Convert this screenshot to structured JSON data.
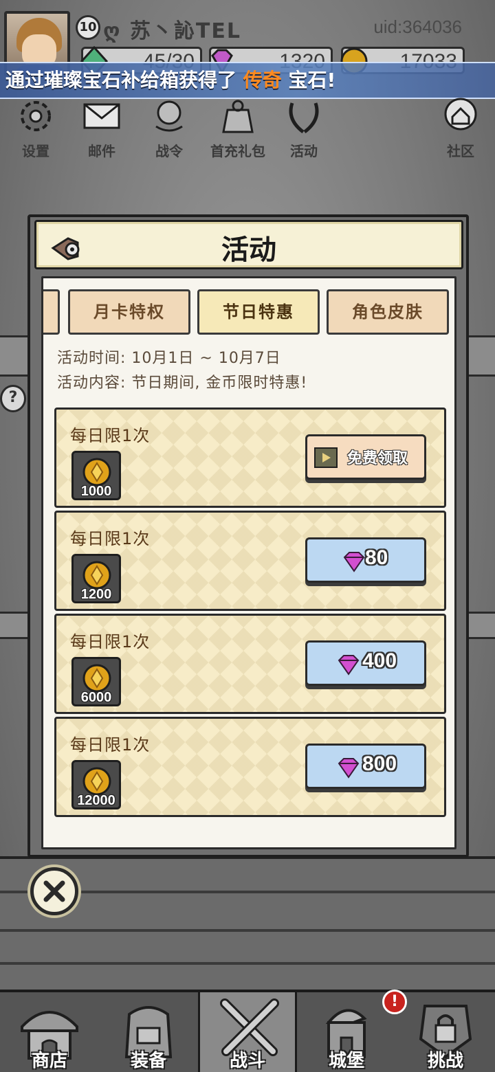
{
  "player": {
    "level": "10",
    "name": "ღ 苏丶訫TEL",
    "uid": "uid:364036"
  },
  "resources": {
    "energy": "45/30",
    "gems": "1320",
    "gold": "17033"
  },
  "banner": {
    "prefix": "通过璀璨宝石补给箱获得了",
    "highlight": "传奇",
    "suffix": "宝石!"
  },
  "top_menu": [
    {
      "label": "设置",
      "icon": "gear-icon"
    },
    {
      "label": "邮件",
      "icon": "mail-icon"
    },
    {
      "label": "战令",
      "icon": "battle-pass-icon"
    },
    {
      "label": "首充礼包",
      "icon": "gift-bag-icon"
    },
    {
      "label": "活动",
      "icon": "laurel-icon"
    },
    {
      "label": "社区",
      "icon": "home-icon"
    }
  ],
  "dialog": {
    "title": "活动",
    "tabs": [
      "月卡特权",
      "节日特惠",
      "角色皮肤"
    ],
    "active_tab": "节日特惠",
    "time_line": "活动时间: 10月1日 ~ 10月7日",
    "content_line": "活动内容: 节日期间, 金币限时特惠!",
    "offers": [
      {
        "limit": "每日限1次",
        "amount": "1000",
        "button": "免费领取",
        "type": "free"
      },
      {
        "limit": "每日限1次",
        "amount": "1200",
        "price": "80",
        "type": "gem"
      },
      {
        "limit": "每日限1次",
        "amount": "6000",
        "price": "400",
        "type": "gem"
      },
      {
        "limit": "每日限1次",
        "amount": "12000",
        "price": "800",
        "type": "gem"
      }
    ]
  },
  "help": "?",
  "bottom_nav": [
    {
      "label": "商店",
      "icon": "shop-icon"
    },
    {
      "label": "装备",
      "icon": "backpack-icon"
    },
    {
      "label": "战斗",
      "icon": "crossed-swords-icon"
    },
    {
      "label": "城堡",
      "icon": "castle-icon"
    },
    {
      "label": "挑战",
      "icon": "locked-challenge-icon"
    }
  ],
  "active_nav": "战斗",
  "alert": "!",
  "colors": {
    "banner_highlight": "#ff8a1e",
    "gem_button": "#bcd8f2",
    "free_button": "#f6dcc0",
    "gem_pink": "#d24fd0",
    "coin_gold": "#e0a21a"
  }
}
